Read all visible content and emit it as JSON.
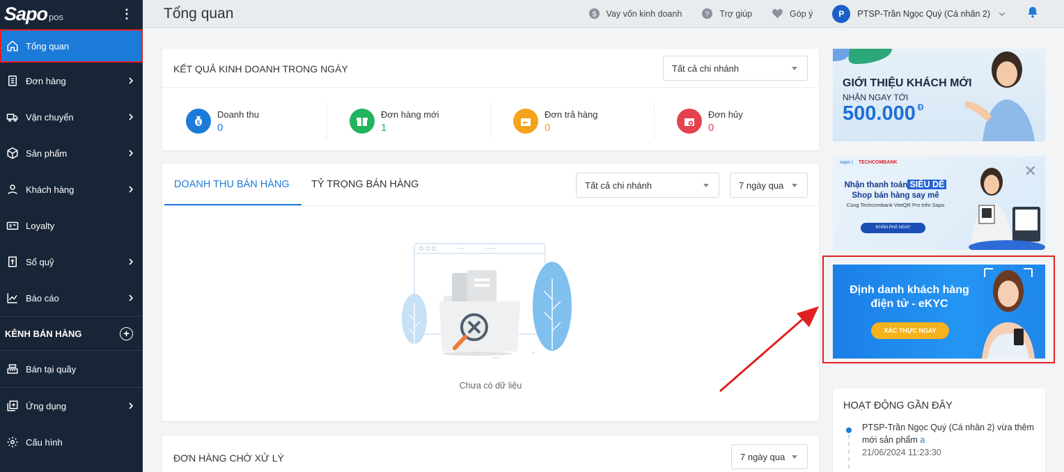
{
  "sidebar": {
    "logo": "Sapo",
    "logo_sub": "pos",
    "items": [
      {
        "label": "Tổng quan",
        "icon": "home-icon",
        "active": true,
        "has_arrow": false
      },
      {
        "label": "Đơn hàng",
        "icon": "clipboard-icon",
        "has_arrow": true
      },
      {
        "label": "Vận chuyển",
        "icon": "truck-icon",
        "has_arrow": true
      },
      {
        "label": "Sản phẩm",
        "icon": "box-icon",
        "has_arrow": true
      },
      {
        "label": "Khách hàng",
        "icon": "user-icon",
        "has_arrow": true
      },
      {
        "label": "Loyalty",
        "icon": "card-icon",
        "has_arrow": false
      },
      {
        "label": "Sổ quỹ",
        "icon": "ledger-icon",
        "has_arrow": true
      },
      {
        "label": "Báo cáo",
        "icon": "chart-icon",
        "has_arrow": true
      }
    ],
    "channel_section": "KÊNH BÁN HÀNG",
    "channel_items": [
      {
        "label": "Bán tại quầy",
        "icon": "cash-register-icon"
      }
    ],
    "bottom_items": [
      {
        "label": "Ứng dụng",
        "icon": "apps-icon",
        "has_arrow": true
      },
      {
        "label": "Cấu hình",
        "icon": "gear-icon",
        "has_arrow": false
      }
    ]
  },
  "header": {
    "title": "Tổng quan",
    "links": [
      {
        "label": "Vay vốn kinh doanh",
        "icon": "dollar-circle-icon"
      },
      {
        "label": "Trợ giúp",
        "icon": "question-circle-icon"
      },
      {
        "label": "Góp ý",
        "icon": "heart-icon"
      }
    ],
    "avatar_letter": "P",
    "user": "PTSP-Trần Ngọc Quý (Cá nhân 2)"
  },
  "daily_results": {
    "title": "KẾT QUẢ KINH DOANH TRONG NGÀY",
    "branch_select": "Tất cả chi nhánh",
    "kpis": [
      {
        "label": "Doanh thu",
        "value": "0",
        "color": "#1c7bd8",
        "icon": "money-bag-icon"
      },
      {
        "label": "Đơn hàng mới",
        "value": "1",
        "color": "#22b35e",
        "icon": "gift-box-icon"
      },
      {
        "label": "Đơn trả hàng",
        "value": "0",
        "color": "#f4a31c",
        "icon": "return-box-icon"
      },
      {
        "label": "Đơn hủy",
        "value": "0",
        "color": "#e5424d",
        "icon": "cancel-box-icon"
      }
    ]
  },
  "sales_chart": {
    "tabs": [
      "DOANH THU BÁN HÀNG",
      "TỶ TRỌNG BÁN HÀNG"
    ],
    "branch_select": "Tất cả chi nhánh",
    "period_select": "7 ngày qua",
    "empty_text": "Chưa có dữ liệu"
  },
  "pending_orders": {
    "title": "ĐƠN HÀNG CHỜ XỬ LÝ",
    "period_select": "7 ngày qua"
  },
  "banners": {
    "referral": {
      "title": "GIỚI THIỆU KHÁCH MỚI",
      "sub": "NHẬN NGAY TỚI",
      "amount": "500.000",
      "currency": "Đ"
    },
    "techcombank": {
      "brand": "sapo",
      "brand2": "TECHCOMBANK",
      "line1_pre": "Nhận thanh toán",
      "line1_hl": "SIÊU DỄ",
      "line2": "Shop bán hàng say mê",
      "line3": "Cùng Techcombank VietQR Pro trên Sapo",
      "button": "KHÁM PHÁ NGAY"
    },
    "ekyc": {
      "line1": "Định danh khách hàng",
      "line2": "điện tử - eKYC",
      "button": "XÁC THỰC NGAY"
    }
  },
  "activity": {
    "title": "HOẠT ĐỘNG GẦN ĐÂY",
    "items": [
      {
        "text": "PTSP-Trần Ngọc Quý (Cá nhân 2) vừa thêm mới sản phẩm",
        "link": "a",
        "time": "21/06/2024 11:23:30"
      }
    ]
  }
}
